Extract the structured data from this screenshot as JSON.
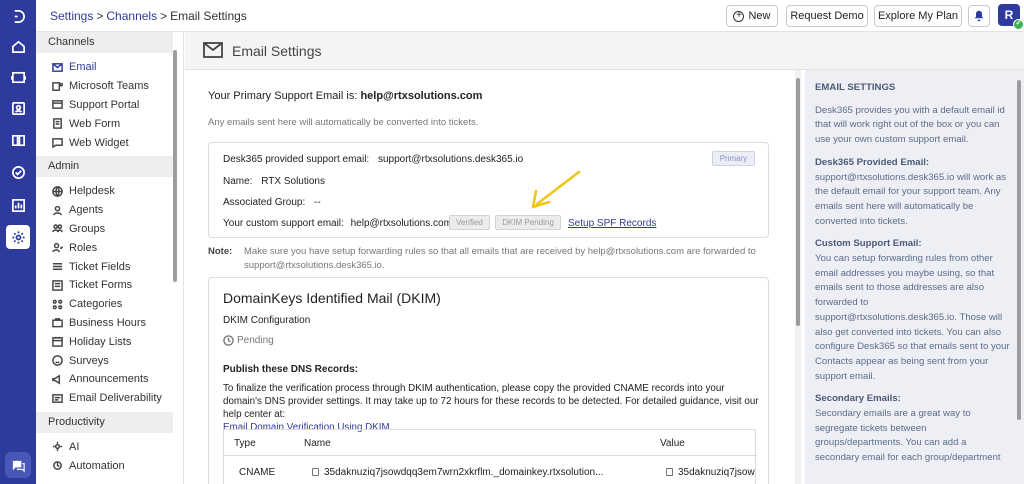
{
  "breadcrumb": [
    "Settings",
    "Channels",
    "Email Settings"
  ],
  "header": {
    "new_label": "New",
    "demo_label": "Request Demo",
    "plan_label": "Explore My Plan",
    "avatar_initial": "R"
  },
  "sidebar": {
    "channels_title": "Channels",
    "channels": [
      "Email",
      "Microsoft Teams",
      "Support Portal",
      "Web Form",
      "Web Widget"
    ],
    "admin_title": "Admin",
    "admin": [
      "Helpdesk",
      "Agents",
      "Groups",
      "Roles",
      "Ticket Fields",
      "Ticket Forms",
      "Categories",
      "Business Hours",
      "Holiday Lists",
      "Surveys",
      "Announcements",
      "Email Deliverability"
    ],
    "productivity_title": "Productivity",
    "productivity": [
      "AI",
      "Automation"
    ]
  },
  "page_title": "Email Settings",
  "primary": {
    "lead": "Your Primary Support Email is:",
    "email": "help@rtxsolutions.com",
    "auto_note": "Any emails sent here will automatically be converted into tickets."
  },
  "card": {
    "provided_label": "Desk365 provided support email:",
    "provided_value": "support@rtxsolutions.desk365.io",
    "primary_badge": "Primary",
    "name_label": "Name:",
    "name_value": "RTX Solutions",
    "group_label": "Associated Group:",
    "group_value": "--",
    "custom_label": "Your custom support email:",
    "custom_value": "help@rtxsolutions.com",
    "verified_badge": "Verified",
    "dkim_badge": "DKIM Pending",
    "spf_link": "Setup SPF Records"
  },
  "note": {
    "label": "Note:",
    "text": "Make sure you have setup forwarding rules so that all emails that are received by help@rtxsolutions.com are forwarded to support@rtxsolutions.desk365.io."
  },
  "dkim": {
    "title": "DomainKeys Identified Mail (DKIM)",
    "config": "DKIM Configuration",
    "status": "Pending",
    "publish": "Publish these DNS Records:",
    "instructions": "To finalize the verification process through DKIM authentication, please copy the provided CNAME records into your domain's DNS provider settings. It may take up to 72 hours for these records to be detected. For detailed guidance, visit our help center at:",
    "help_link": "Email Domain Verification Using DKIM.",
    "table": {
      "headers": [
        "Type",
        "Name",
        "Value"
      ],
      "row": {
        "type": "CNAME",
        "name": "35daknuziq7jsowdqq3em7wrn2xkrflm._domainkey.rtxsolution...",
        "value": "35daknuziq7jsow"
      }
    }
  },
  "help": {
    "title": "EMAIL SETTINGS",
    "intro": "Desk365 provides you with a default email id that will work right out of the box or you can use your own custom support email.",
    "provided_title": "Desk365 Provided Email:",
    "provided_text": "support@rtxsolutions.desk365.io will work as the default email for your support team. Any emails sent here will automatically be converted into tickets.",
    "custom_title": "Custom Support Email:",
    "custom_text": "You can setup forwarding rules from other email addresses you maybe using, so that emails sent to those addresses are also forwarded to support@rtxsolutions.desk365.io. Those will also get converted into tickets. You can also configure Desk365 so that emails sent to your Contacts appear as being sent from your support email.",
    "secondary_title": "Secondary Emails:",
    "secondary_text": "Secondary emails are a great way to segregate tickets between groups/departments. You can add a secondary email for each group/department"
  },
  "colors": {
    "rail": "#2f3b9c",
    "accent": "#2f3b9c",
    "arrow": "#f2c619",
    "help_bg": "#eeeff4"
  }
}
